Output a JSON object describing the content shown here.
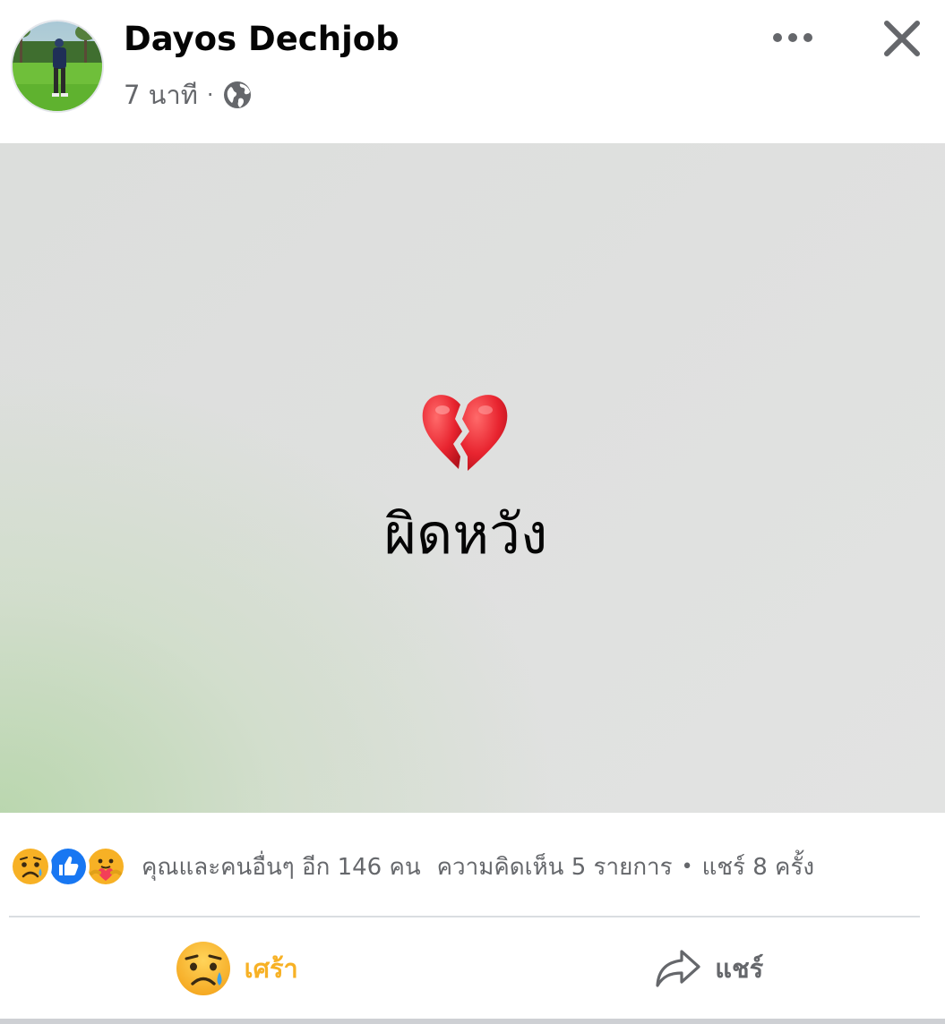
{
  "post": {
    "author": "Dayos Dechjob",
    "time": "7 นาที",
    "separator": "·",
    "privacy_icon": "globe-icon",
    "more_icon": "more-horizontal-icon",
    "close_icon": "close-icon"
  },
  "status": {
    "emoji_icon": "broken-heart-icon",
    "text": "ผิดหวัง",
    "background_colors": [
      "#dedfde",
      "#b8d6ac"
    ]
  },
  "reactions": {
    "icons": [
      "sad-reaction-icon",
      "like-reaction-icon",
      "care-reaction-icon"
    ],
    "count_text": "คุณและคนอื่นๆ อีก 146 คน",
    "comments_text": "ความคิดเห็น 5 รายการ",
    "dot": "•",
    "shares_text": "แชร์ 8 ครั้ง"
  },
  "actions": {
    "reaction_label": "เศร้า",
    "share_label": "แชร์"
  },
  "colors": {
    "sad_accent": "#f7b125",
    "like_blue": "#1877f2",
    "muted_text": "#65676b"
  }
}
